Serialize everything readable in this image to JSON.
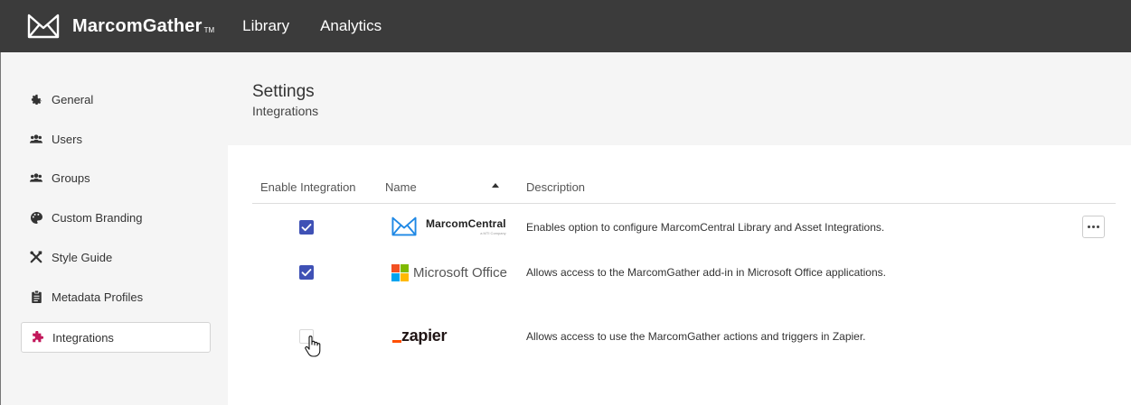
{
  "header": {
    "brand_name": "MarcomGather",
    "brand_tm": "TM",
    "nav": [
      "Library",
      "Analytics"
    ]
  },
  "sidebar": {
    "items": [
      {
        "label": "General",
        "icon": "gear-icon"
      },
      {
        "label": "Users",
        "icon": "users-icon"
      },
      {
        "label": "Groups",
        "icon": "groups-icon"
      },
      {
        "label": "Custom Branding",
        "icon": "palette-icon"
      },
      {
        "label": "Style Guide",
        "icon": "tools-icon"
      },
      {
        "label": "Metadata Profiles",
        "icon": "clipboard-icon"
      },
      {
        "label": "Integrations",
        "icon": "puzzle-icon",
        "active": true
      }
    ]
  },
  "page": {
    "title": "Settings",
    "subtitle": "Integrations"
  },
  "table": {
    "columns": [
      "Enable Integration",
      "Name",
      "Description"
    ],
    "sort_column": "Name",
    "sort_direction": "ascending",
    "rows": [
      {
        "name": "MarcomCentral",
        "logo_sub": "a MTI Company",
        "enabled": true,
        "description": "Enables option to configure MarcomCentral Library and Asset Integrations."
      },
      {
        "name": "Microsoft Office",
        "enabled": true,
        "description": "Allows access to the MarcomGather add-in in Microsoft Office applications."
      },
      {
        "name": "zapier",
        "enabled": false,
        "description": "Allows access to use the MarcomGather actions and triggers in Zapier."
      }
    ]
  },
  "colors": {
    "topbar": "#3b3b3b",
    "checkbox_checked": "#3f51b5",
    "integrations_icon": "#c2185b",
    "ms_red": "#f25022",
    "ms_green": "#7fba00",
    "ms_blue": "#00a4ef",
    "ms_yellow": "#ffb900",
    "zapier_orange": "#ff4f00",
    "marcom_blue": "#1e88e5"
  }
}
